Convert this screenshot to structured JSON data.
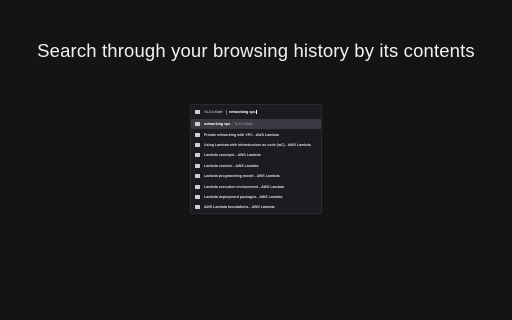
{
  "headline": "Search through your browsing history by its contents",
  "popup": {
    "search": {
      "scope_label": "To-Do Mate",
      "query": "networking vpc"
    },
    "results": [
      {
        "title": "networking vpc",
        "sub": "- To-Do Mate",
        "selected": true
      },
      {
        "title": "Private networking with VPC - AWS Lambda",
        "sub": "",
        "selected": false
      },
      {
        "title": "Using Lambda with infrastructure as code (IaC) - AWS Lambda",
        "sub": "",
        "selected": false
      },
      {
        "title": "Lambda concepts - AWS Lambda",
        "sub": "",
        "selected": false
      },
      {
        "title": "Lambda console - AWS Lambda",
        "sub": "",
        "selected": false
      },
      {
        "title": "Lambda programming model - AWS Lambda",
        "sub": "",
        "selected": false
      },
      {
        "title": "Lambda execution environment - AWS Lambda",
        "sub": "",
        "selected": false
      },
      {
        "title": "Lambda deployment packages - AWS Lambda",
        "sub": "",
        "selected": false
      },
      {
        "title": "AWS Lambda foundations - AWS Lambda",
        "sub": "",
        "selected": false
      }
    ]
  },
  "colors": {
    "background": "#141414",
    "popup_background": "#1b1c21",
    "selected_row": "#3a3b42"
  },
  "icons": {
    "search_bar": "tab-icon",
    "result": "page-icon"
  }
}
